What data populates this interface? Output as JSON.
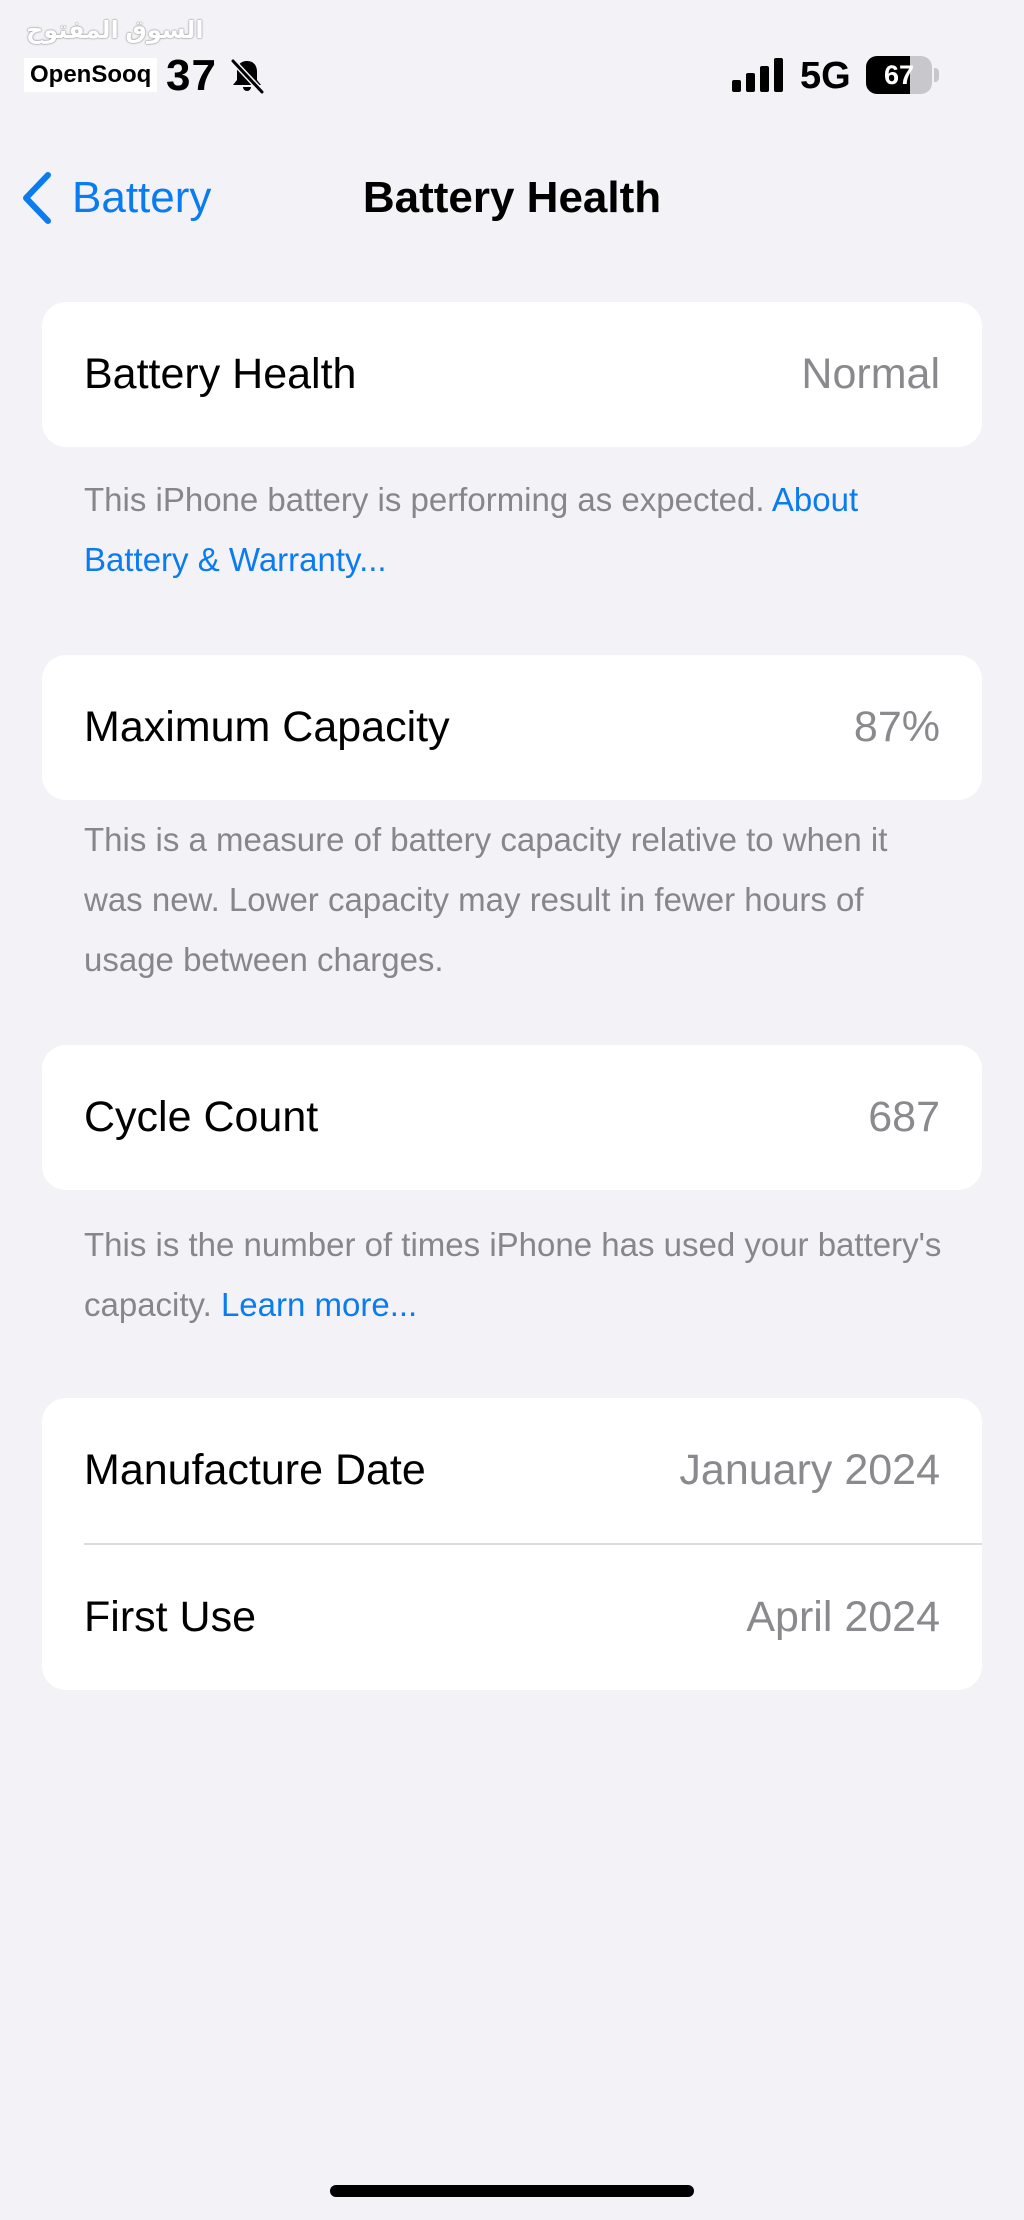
{
  "watermark": {
    "arabic": "السوق المفتوح",
    "latin": "OpenSooq"
  },
  "status_bar": {
    "time": "37",
    "network": "5G",
    "battery_level": "67",
    "battery_fraction": 0.67,
    "icons": [
      "bell-slash-icon",
      "signal-bars-icon",
      "battery-icon"
    ]
  },
  "nav": {
    "back_label": "Battery",
    "back_icon": "chevron-left-icon",
    "title": "Battery Health"
  },
  "health": {
    "label": "Battery Health",
    "value": "Normal",
    "footer_text": "This iPhone battery is performing as expected. ",
    "footer_link": "About Battery & Warranty..."
  },
  "capacity": {
    "label": "Maximum Capacity",
    "value": "87%",
    "footer_text": "This is a measure of battery capacity relative to when it was new. Lower capacity may result in fewer hours of usage between charges."
  },
  "cycles": {
    "label": "Cycle Count",
    "value": "687",
    "footer_text": "This is the number of times iPhone has used your battery's capacity. ",
    "footer_link": "Learn more..."
  },
  "dates": {
    "manufacture_label": "Manufacture Date",
    "manufacture_value": "January 2024",
    "first_use_label": "First Use",
    "first_use_value": "April 2024"
  },
  "colors": {
    "background": "#f2f2f7",
    "accent": "#0a7cf0",
    "secondary_text": "#8a8a8e"
  }
}
